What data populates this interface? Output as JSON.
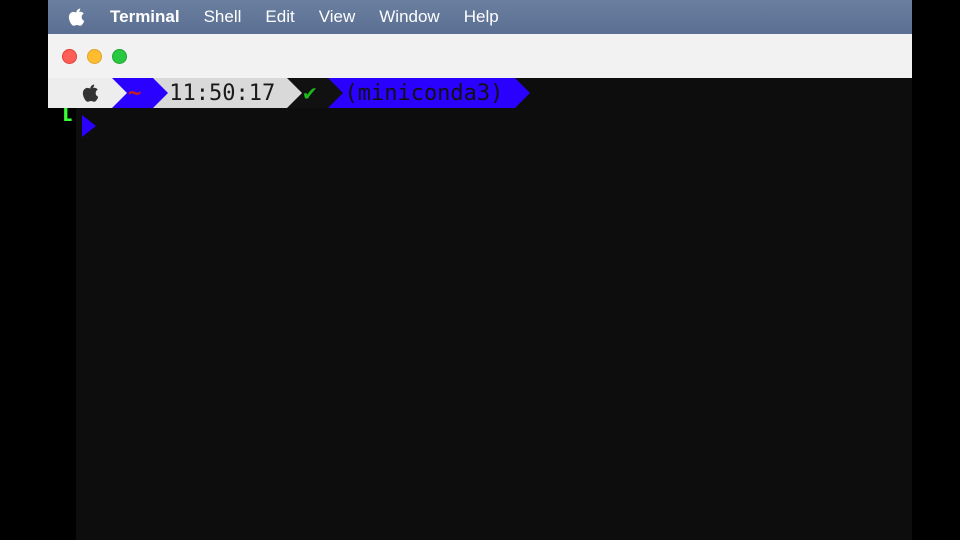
{
  "menubar": {
    "app_name": "Terminal",
    "items": [
      "Shell",
      "Edit",
      "View",
      "Window",
      "Help"
    ]
  },
  "prompt": {
    "cwd": "~",
    "time": "11:50:17",
    "status_symbol": "✔",
    "env": "(miniconda3)"
  }
}
